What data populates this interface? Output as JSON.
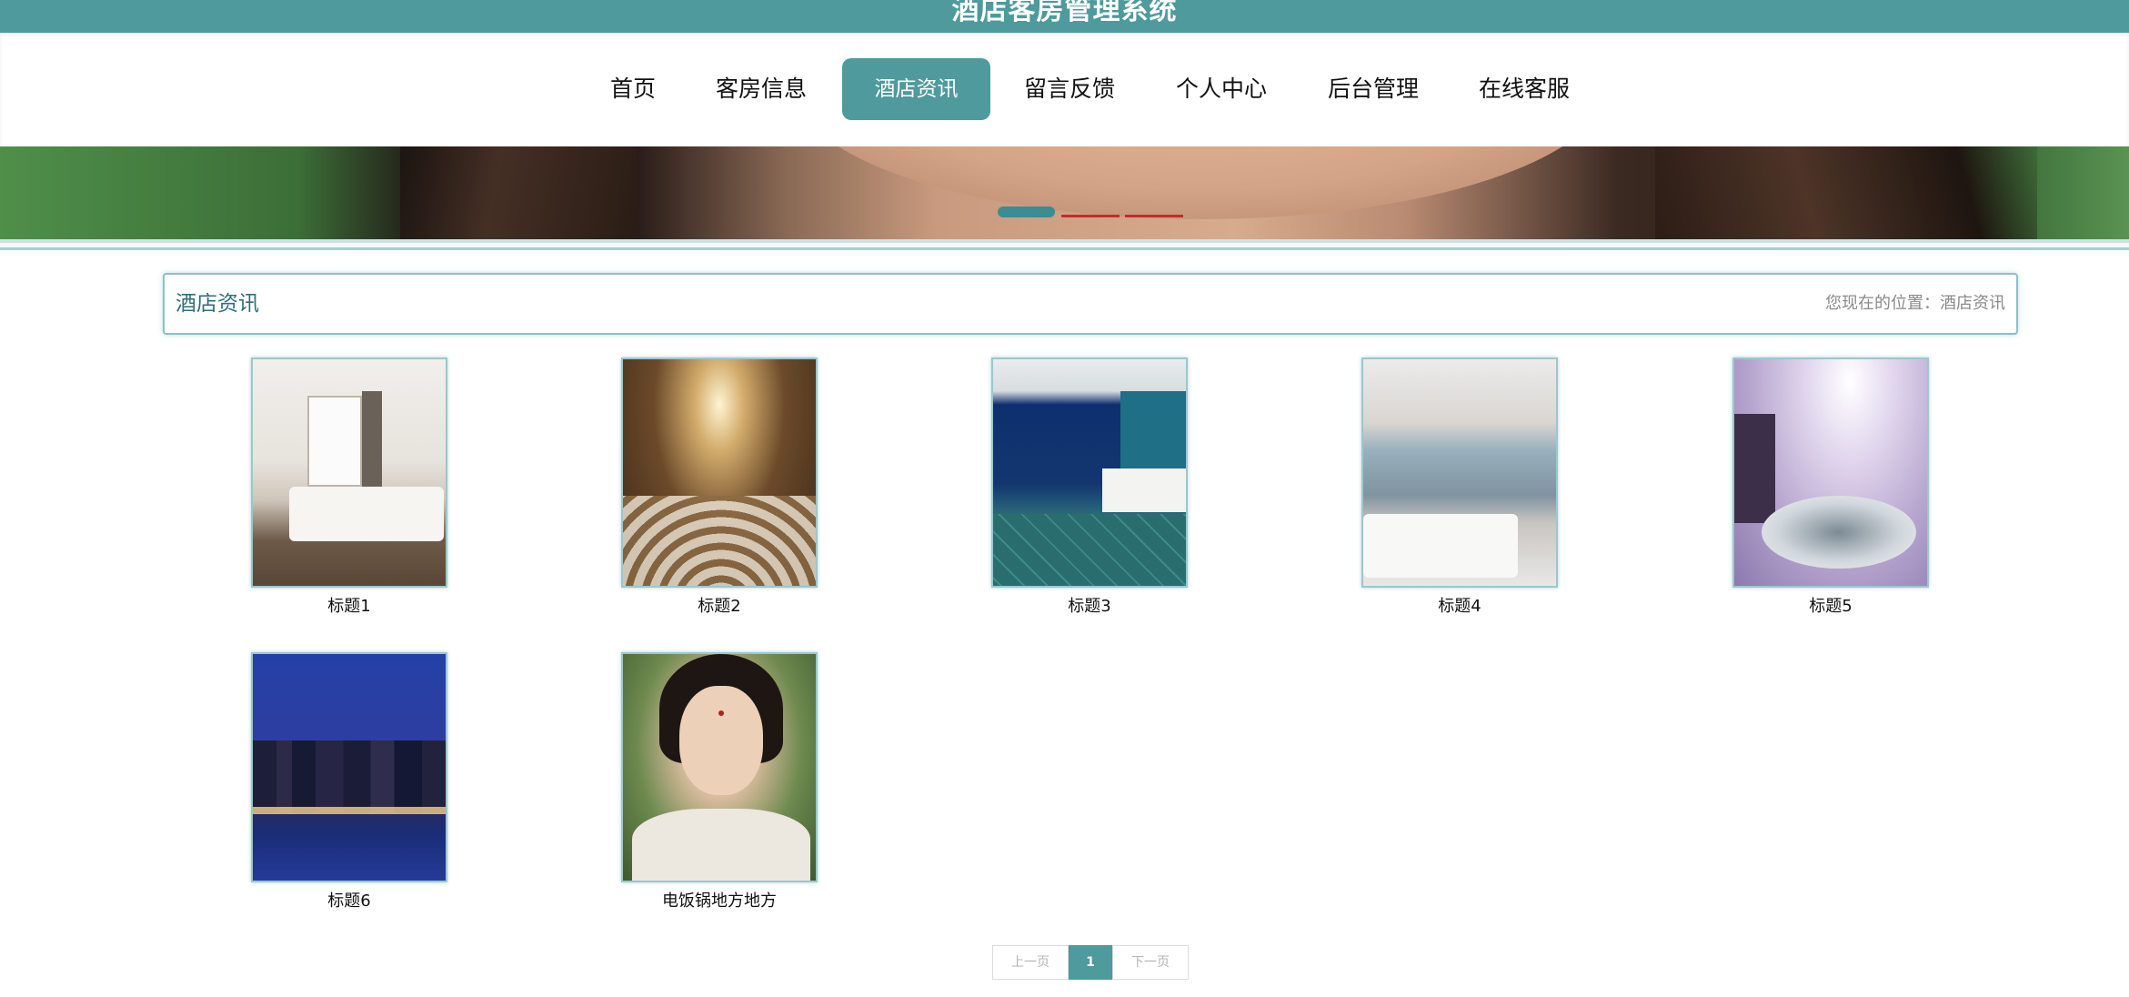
{
  "site": {
    "title": "酒店客房管理系统"
  },
  "nav": {
    "items": [
      {
        "label": "首页",
        "active": false
      },
      {
        "label": "客房信息",
        "active": false
      },
      {
        "label": "酒店资讯",
        "active": true
      },
      {
        "label": "留言反馈",
        "active": false
      },
      {
        "label": "个人中心",
        "active": false
      },
      {
        "label": "后台管理",
        "active": false
      },
      {
        "label": "在线客服",
        "active": false
      }
    ]
  },
  "banner": {
    "slide_count": 3,
    "active_slide": 1
  },
  "section": {
    "title": "酒店资讯",
    "breadcrumb": "您现在的位置：酒店资讯"
  },
  "news": [
    {
      "title": "标题1"
    },
    {
      "title": "标题2"
    },
    {
      "title": "标题3"
    },
    {
      "title": "标题4"
    },
    {
      "title": "标题5"
    },
    {
      "title": "标题6"
    },
    {
      "title": "电饭锅地方地方"
    }
  ],
  "pagination": {
    "prev_label": "上一页",
    "current_page": "1",
    "next_label": "下一页"
  },
  "colors": {
    "accent": "#4e9a9c",
    "slider_inactive": "#c12d2d"
  }
}
